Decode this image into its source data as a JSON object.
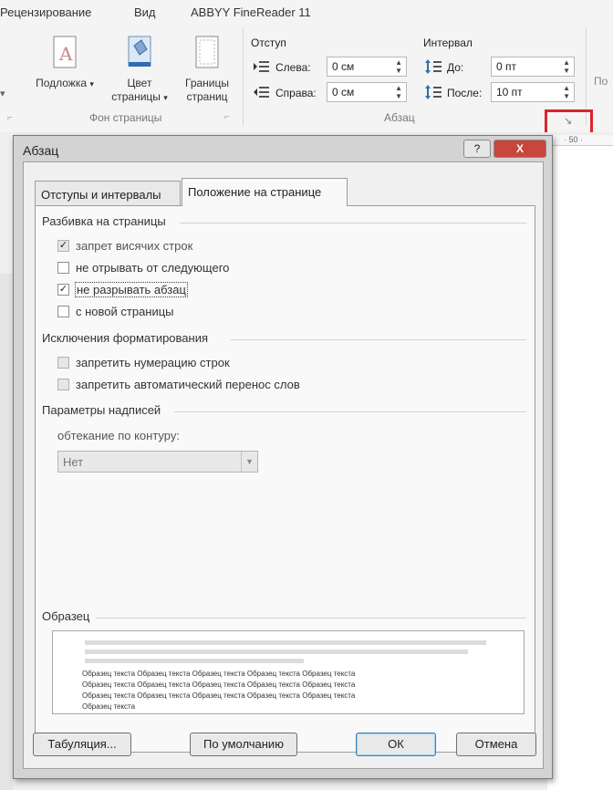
{
  "ribbon": {
    "tabs": [
      "Рецензирование",
      "Вид",
      "ABBYY FineReader 11"
    ],
    "buttons": {
      "watermark": "Подложка",
      "page_color_1": "Цвет",
      "page_color_2": "страницы",
      "borders_1": "Границы",
      "borders_2": "страниц"
    },
    "group_page_background": "Фон страницы",
    "group_paragraph": "Абзац",
    "indent": {
      "title": "Отступ",
      "left_label": "Слева:",
      "left_value": "0 см",
      "right_label": "Справа:",
      "right_value": "0 см"
    },
    "spacing": {
      "title": "Интервал",
      "before_label": "До:",
      "before_value": "0 пт",
      "after_label": "После:",
      "after_value": "10 пт"
    },
    "right_partial": "По"
  },
  "ruler": {
    "mark": "· 50 ·"
  },
  "dialog": {
    "title": "Абзац",
    "help_label": "?",
    "close_label": "X",
    "tabs": [
      "Отступы и интервалы",
      "Положение на странице"
    ],
    "active_tab": 1,
    "pagination": {
      "title": "Разбивка на страницы",
      "options": [
        {
          "label": "запрет висячих строк",
          "checked": true,
          "disabled": true
        },
        {
          "label": "не отрывать от следующего",
          "checked": false,
          "disabled": false
        },
        {
          "label": "не разрывать абзац",
          "checked": true,
          "disabled": false
        },
        {
          "label": "с новой страницы",
          "checked": false,
          "disabled": false
        }
      ]
    },
    "formatting_exceptions": {
      "title": "Исключения форматирования",
      "options": [
        {
          "label": "запретить нумерацию строк",
          "checked": false
        },
        {
          "label": "запретить автоматический перенос слов",
          "checked": false
        }
      ]
    },
    "textbox": {
      "title": "Параметры надписей",
      "wrap_label": "обтекание по контуру:",
      "wrap_value": "Нет"
    },
    "sample": {
      "title": "Образец",
      "lines": [
        "Образец текста Образец текста Образец текста Образец текста Образец текста",
        "Образец текста Образец текста Образец текста Образец текста Образец текста",
        "Образец текста Образец текста Образец текста Образец текста Образец текста",
        "Образец текста"
      ]
    },
    "buttons": {
      "tabs": "Табуляция...",
      "default": "По умолчанию",
      "ok": "ОК",
      "cancel": "Отмена"
    }
  },
  "colors": {
    "highlight": "#d9252b",
    "ok_border": "#3c7fb1"
  }
}
